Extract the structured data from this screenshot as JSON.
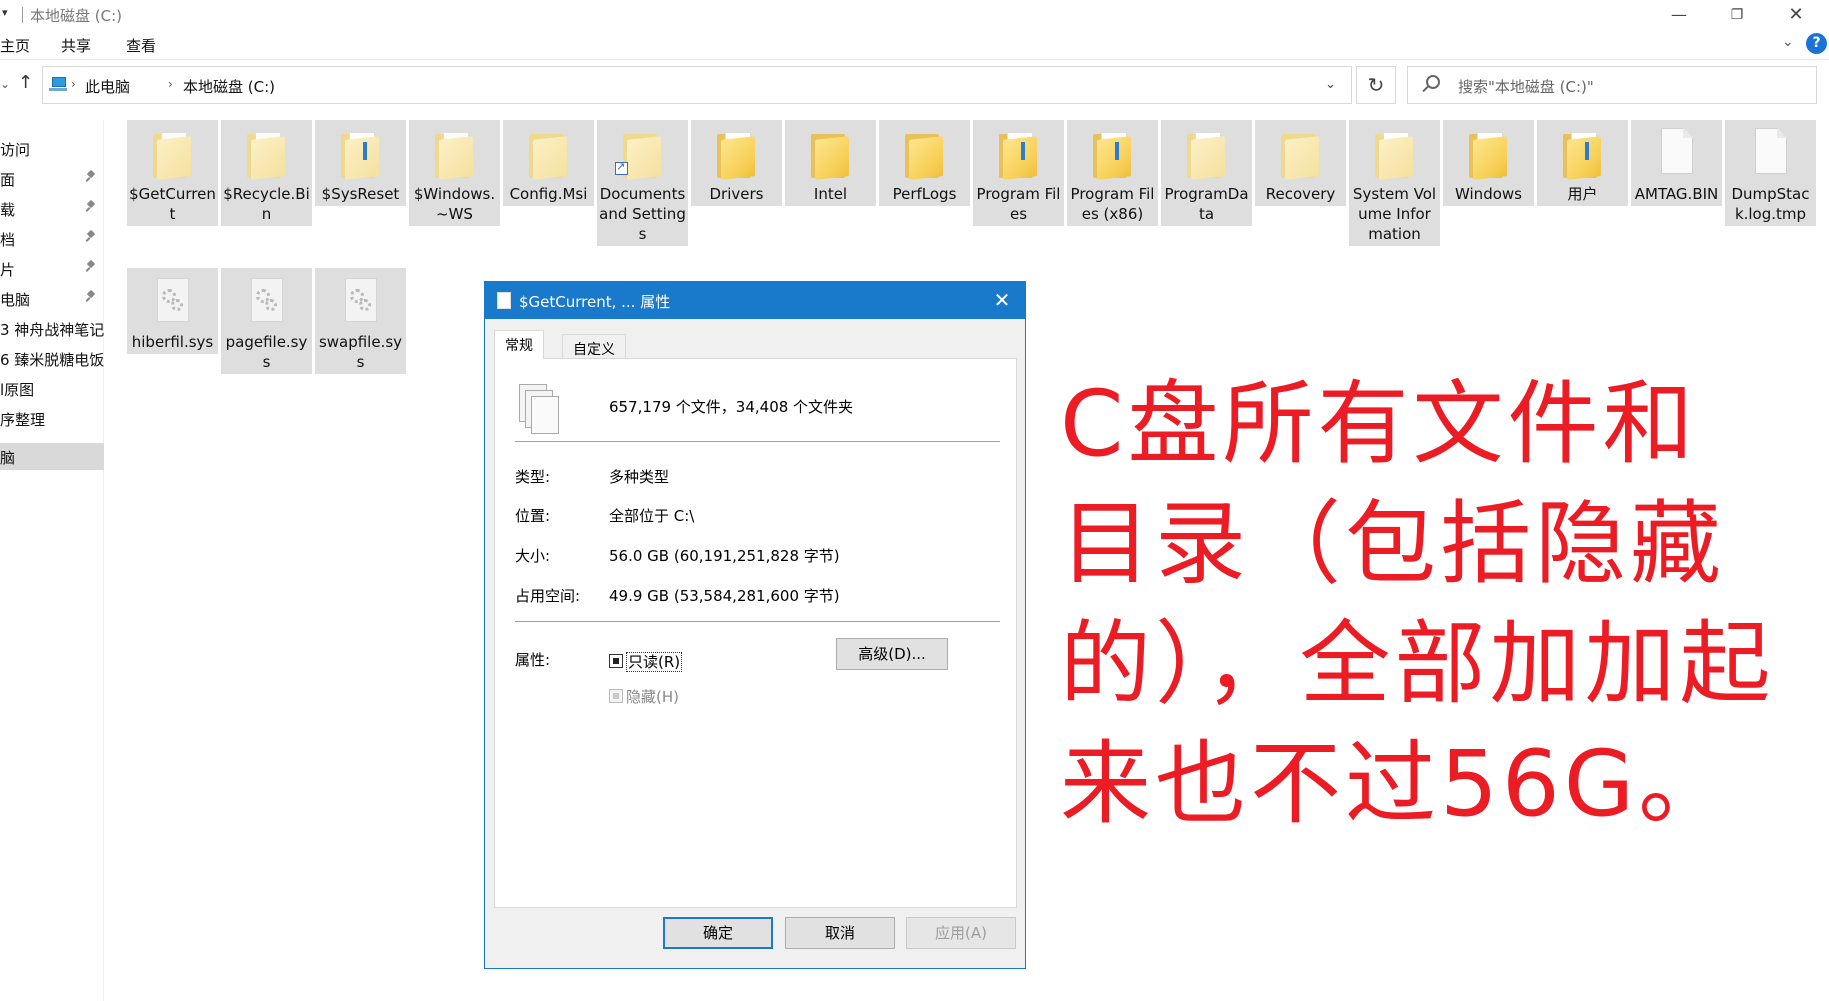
{
  "window": {
    "title": "本地磁盘 (C:)",
    "minimize": "—",
    "maximize": "❐",
    "close": "✕"
  },
  "ribbon": {
    "tabs": [
      "主页",
      "共享",
      "查看"
    ],
    "expand_icon": "chevron-down-icon",
    "help": "?"
  },
  "address": {
    "crumbs": [
      "此电脑",
      "本地磁盘 (C:)"
    ],
    "search_placeholder": "搜索\"本地磁盘 (C:)\""
  },
  "sidebar": {
    "items": [
      {
        "label": "访问",
        "pinned": false,
        "selected": false
      },
      {
        "label": "面",
        "pinned": true,
        "selected": false
      },
      {
        "label": "载",
        "pinned": true,
        "selected": false
      },
      {
        "label": "档",
        "pinned": true,
        "selected": false
      },
      {
        "label": "片",
        "pinned": true,
        "selected": false
      },
      {
        "label": "电脑",
        "pinned": true,
        "selected": false
      },
      {
        "label": "3 神舟战神笔记",
        "pinned": false,
        "selected": false
      },
      {
        "label": "6 臻米脱糖电饭",
        "pinned": false,
        "selected": false
      },
      {
        "label": "l原图",
        "pinned": false,
        "selected": false
      },
      {
        "label": "序整理",
        "pinned": false,
        "selected": false
      },
      {
        "label": "脑",
        "pinned": false,
        "selected": true
      }
    ]
  },
  "files": [
    {
      "name": "$GetCurrent",
      "kind": "folder-faded"
    },
    {
      "name": "$Recycle.Bin",
      "kind": "folder-faded"
    },
    {
      "name": "$SysReset",
      "kind": "folder-faded"
    },
    {
      "name": "$Windows.~WS",
      "kind": "folder-faded"
    },
    {
      "name": "Config.Msi",
      "kind": "folder-faded"
    },
    {
      "name": "Documents and Settings",
      "kind": "folder-shortcut"
    },
    {
      "name": "Drivers",
      "kind": "folder-doc"
    },
    {
      "name": "Intel",
      "kind": "folder"
    },
    {
      "name": "PerfLogs",
      "kind": "folder"
    },
    {
      "name": "Program Files",
      "kind": "folder-doc"
    },
    {
      "name": "Program Files (x86)",
      "kind": "folder-doc"
    },
    {
      "name": "ProgramData",
      "kind": "folder-faded-doc"
    },
    {
      "name": "Recovery",
      "kind": "folder-faded"
    },
    {
      "name": "System Volume Information",
      "kind": "folder-faded-doc"
    },
    {
      "name": "Windows",
      "kind": "folder-doc"
    },
    {
      "name": "用户",
      "kind": "folder-doc"
    },
    {
      "name": "AMTAG.BIN",
      "kind": "file"
    },
    {
      "name": "DumpStack.log.tmp",
      "kind": "file"
    },
    {
      "name": "hiberfil.sys",
      "kind": "sysfile"
    },
    {
      "name": "pagefile.sys",
      "kind": "sysfile"
    },
    {
      "name": "swapfile.sys",
      "kind": "sysfile"
    }
  ],
  "dialog": {
    "title": "$GetCurrent, ... 属性",
    "tabs": {
      "general": "常规",
      "custom": "自定义"
    },
    "summary": "657,179 个文件，34,408 个文件夹",
    "type_label": "类型:",
    "type_value": "多种类型",
    "location_label": "位置:",
    "location_value": "全部位于 C:\\",
    "size_label": "大小:",
    "size_value": "56.0 GB (60,191,251,828 字节)",
    "disk_label": "占用空间:",
    "disk_value": "49.9 GB (53,584,281,600 字节)",
    "attr_label": "属性:",
    "readonly_label": "只读(R)",
    "readonly_state": "indeterminate",
    "hidden_label": "隐藏(H)",
    "hidden_state": "disabled",
    "advanced_button": "高级(D)...",
    "ok_button": "确定",
    "cancel_button": "取消",
    "apply_button": "应用(A)"
  },
  "annotation": {
    "text": "C盘所有文件和目录（包括隐藏的），全部加加起来也不过56G。",
    "color": "#ec1c24"
  }
}
